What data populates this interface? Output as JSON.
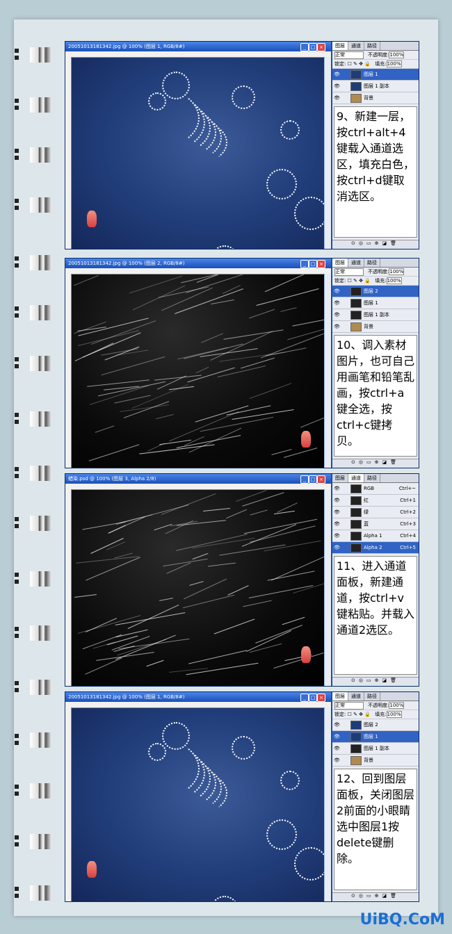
{
  "panels": [
    {
      "window_title": "20051013181342.jpg @ 100% (图层 1, RGB/8#)",
      "canvas": "blue",
      "tabs": [
        "图层",
        "通道",
        "路径"
      ],
      "active_tab": 0,
      "blend_mode": "正常",
      "opacity_label": "不透明度:",
      "opacity_value": "100%",
      "lock_label": "锁定:",
      "fill_label": "填充:",
      "fill_value": "100%",
      "rows": [
        {
          "name": "图层 1",
          "selected": true,
          "shortcut": ""
        },
        {
          "name": "图层 1 副本",
          "selected": false,
          "shortcut": ""
        },
        {
          "name": "背景",
          "selected": false,
          "shortcut": ""
        }
      ],
      "step": "9、新建一层，按ctrl+alt+4键载入通道选区，填充白色，按ctrl+d键取消选区。"
    },
    {
      "window_title": "20051013181342.jpg @ 100% (图层 2, RGB/8#)",
      "canvas": "black",
      "tabs": [
        "图层",
        "通道",
        "路径"
      ],
      "active_tab": 0,
      "blend_mode": "正常",
      "opacity_label": "不透明度:",
      "opacity_value": "100%",
      "lock_label": "锁定:",
      "fill_label": "填充:",
      "fill_value": "100%",
      "rows": [
        {
          "name": "图层 2",
          "selected": true,
          "shortcut": ""
        },
        {
          "name": "图层 1",
          "selected": false,
          "shortcut": ""
        },
        {
          "name": "图层 1 副本",
          "selected": false,
          "shortcut": ""
        },
        {
          "name": "背景",
          "selected": false,
          "shortcut": ""
        }
      ],
      "step": "10、调入素材图片，也可自己用画笔和铅笔乱画，按ctrl+a键全选，按ctrl+c键拷贝。"
    },
    {
      "window_title": "蜡染.psd @ 100% (图层 3, Alpha 2/8)",
      "canvas": "black",
      "tabs": [
        "图层",
        "通道",
        "路径"
      ],
      "active_tab": 1,
      "rows": [
        {
          "name": "RGB",
          "selected": false,
          "shortcut": "Ctrl+~"
        },
        {
          "name": "红",
          "selected": false,
          "shortcut": "Ctrl+1"
        },
        {
          "name": "绿",
          "selected": false,
          "shortcut": "Ctrl+2"
        },
        {
          "name": "蓝",
          "selected": false,
          "shortcut": "Ctrl+3"
        },
        {
          "name": "Alpha 1",
          "selected": false,
          "shortcut": "Ctrl+4"
        },
        {
          "name": "Alpha 2",
          "selected": true,
          "shortcut": "Ctrl+5"
        }
      ],
      "step": "11、进入通道面板，新建通道，按ctrl+v键粘贴。并载入通道2选区。"
    },
    {
      "window_title": "20051013181342.jpg @ 100% (图层 1, RGB/8#)",
      "canvas": "blue",
      "tabs": [
        "图层",
        "通道",
        "路径"
      ],
      "active_tab": 0,
      "blend_mode": "正常",
      "opacity_label": "不透明度:",
      "opacity_value": "100%",
      "lock_label": "锁定:",
      "fill_label": "填充:",
      "fill_value": "100%",
      "rows": [
        {
          "name": "图层 2",
          "selected": false,
          "shortcut": ""
        },
        {
          "name": "图层 1",
          "selected": true,
          "shortcut": ""
        },
        {
          "name": "图层 1 副本",
          "selected": false,
          "shortcut": ""
        },
        {
          "name": "背景",
          "selected": false,
          "shortcut": ""
        }
      ],
      "step": "12、回到图层面板，关闭图层2前面的小眼睛选中图层1按delete键删除。"
    }
  ],
  "watermark": "UiBQ.CoM",
  "colors": {
    "selected_row": "#3163c4",
    "watermark": "#1a6fd6"
  }
}
